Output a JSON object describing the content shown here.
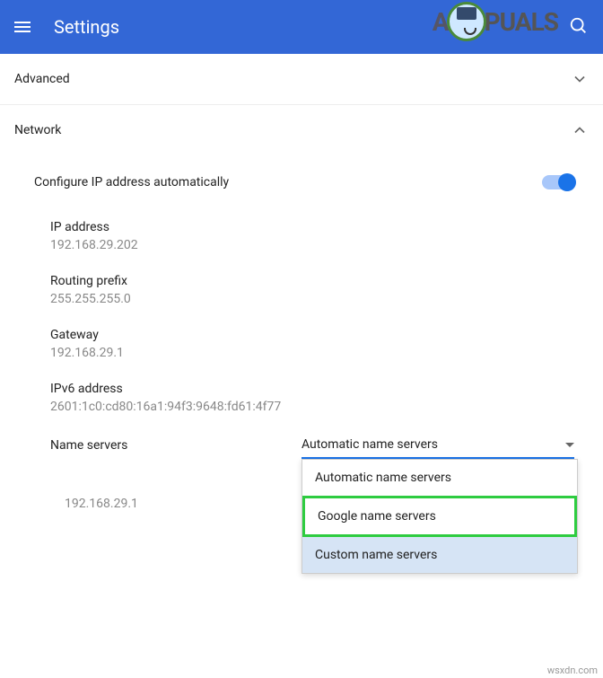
{
  "header": {
    "title": "Settings",
    "logo_prefix": "A",
    "logo_suffix": "PUALS"
  },
  "sections": {
    "advanced": {
      "label": "Advanced",
      "expanded": false
    },
    "network": {
      "label": "Network",
      "expanded": true
    }
  },
  "network": {
    "configure_auto": {
      "label": "Configure IP address automatically",
      "enabled": true
    },
    "fields": {
      "ip_address": {
        "label": "IP address",
        "value": "192.168.29.202"
      },
      "routing_prefix": {
        "label": "Routing prefix",
        "value": "255.255.255.0"
      },
      "gateway": {
        "label": "Gateway",
        "value": "192.168.29.1"
      },
      "ipv6_address": {
        "label": "IPv6 address",
        "value": "2601:1c0:cd80:16a1:94f3:9648:fd61:4f77"
      }
    },
    "nameservers": {
      "label": "Name servers",
      "selected": "Automatic name servers",
      "options": [
        "Automatic name servers",
        "Google name servers",
        "Custom name servers"
      ],
      "highlighted_index": 1,
      "current_value": "192.168.29.1"
    }
  },
  "watermark": "wsxdn.com"
}
